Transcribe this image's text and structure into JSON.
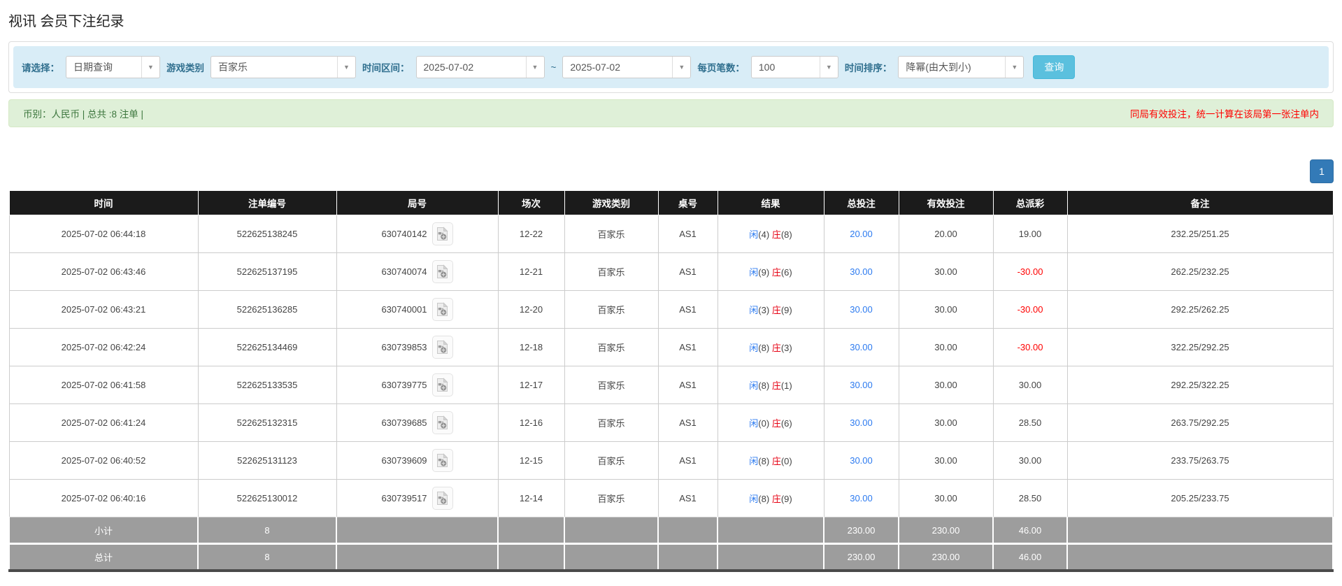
{
  "page": {
    "title": "视讯 会员下注纪录"
  },
  "colors": {
    "accent_blue": "#2d7bf0",
    "banker_red": "#e60012",
    "negative_red": "#ff0000",
    "header_bg": "#1b1b1b",
    "footer_bg": "#9d9d9d",
    "filter_bg": "#d9edf7",
    "filter_label": "#31708f",
    "summary_bg": "#dff0d8",
    "summary_text": "#3c763d",
    "button_bg": "#5bc0de",
    "button_border": "#46b8da",
    "pagination_bg": "#337ab7",
    "pagination_border": "#2e6da4"
  },
  "filters": {
    "select_label": "请选择：",
    "select_value": "日期查询",
    "game_type_label": "游戏类别",
    "game_type_value": "百家乐",
    "time_range_label": "时间区间：",
    "date_from": "2025-07-02",
    "tilde": "~",
    "date_to": "2025-07-02",
    "page_size_label": "每页笔数：",
    "page_size_value": "100",
    "sort_label": "时间排序：",
    "sort_value": "降幂(由大到小)",
    "search_button": "查询"
  },
  "summary": {
    "left": "币别：人民币 | 总共 :8 注单 |",
    "right": "同局有效投注，统一计算在该局第一张注单内"
  },
  "pagination": {
    "page": "1"
  },
  "table": {
    "headers": [
      "时间",
      "注单编号",
      "局号",
      "场次",
      "游戏类别",
      "桌号",
      "结果",
      "总投注",
      "有效投注",
      "总派彩",
      "备注"
    ],
    "rows": [
      {
        "time": "2025-07-02 06:44:18",
        "bet_id": "522625138245",
        "round_id": "630740142",
        "session": "12-22",
        "game": "百家乐",
        "table_no": "AS1",
        "player": "闲",
        "player_score": "(4)",
        "banker": "庄",
        "banker_score": "(8)",
        "total_bet": "20.00",
        "valid_bet": "20.00",
        "payout": "19.00",
        "remark": "232.25/251.25"
      },
      {
        "time": "2025-07-02 06:43:46",
        "bet_id": "522625137195",
        "round_id": "630740074",
        "session": "12-21",
        "game": "百家乐",
        "table_no": "AS1",
        "player": "闲",
        "player_score": "(9)",
        "banker": "庄",
        "banker_score": "(6)",
        "total_bet": "30.00",
        "valid_bet": "30.00",
        "payout": "-30.00",
        "remark": "262.25/232.25"
      },
      {
        "time": "2025-07-02 06:43:21",
        "bet_id": "522625136285",
        "round_id": "630740001",
        "session": "12-20",
        "game": "百家乐",
        "table_no": "AS1",
        "player": "闲",
        "player_score": "(3)",
        "banker": "庄",
        "banker_score": "(9)",
        "total_bet": "30.00",
        "valid_bet": "30.00",
        "payout": "-30.00",
        "remark": "292.25/262.25"
      },
      {
        "time": "2025-07-02 06:42:24",
        "bet_id": "522625134469",
        "round_id": "630739853",
        "session": "12-18",
        "game": "百家乐",
        "table_no": "AS1",
        "player": "闲",
        "player_score": "(8)",
        "banker": "庄",
        "banker_score": "(3)",
        "total_bet": "30.00",
        "valid_bet": "30.00",
        "payout": "-30.00",
        "remark": "322.25/292.25"
      },
      {
        "time": "2025-07-02 06:41:58",
        "bet_id": "522625133535",
        "round_id": "630739775",
        "session": "12-17",
        "game": "百家乐",
        "table_no": "AS1",
        "player": "闲",
        "player_score": "(8)",
        "banker": "庄",
        "banker_score": "(1)",
        "total_bet": "30.00",
        "valid_bet": "30.00",
        "payout": "30.00",
        "remark": "292.25/322.25"
      },
      {
        "time": "2025-07-02 06:41:24",
        "bet_id": "522625132315",
        "round_id": "630739685",
        "session": "12-16",
        "game": "百家乐",
        "table_no": "AS1",
        "player": "闲",
        "player_score": "(0)",
        "banker": "庄",
        "banker_score": "(6)",
        "total_bet": "30.00",
        "valid_bet": "30.00",
        "payout": "28.50",
        "remark": "263.75/292.25"
      },
      {
        "time": "2025-07-02 06:40:52",
        "bet_id": "522625131123",
        "round_id": "630739609",
        "session": "12-15",
        "game": "百家乐",
        "table_no": "AS1",
        "player": "闲",
        "player_score": "(8)",
        "banker": "庄",
        "banker_score": "(0)",
        "total_bet": "30.00",
        "valid_bet": "30.00",
        "payout": "30.00",
        "remark": "233.75/263.75"
      },
      {
        "time": "2025-07-02 06:40:16",
        "bet_id": "522625130012",
        "round_id": "630739517",
        "session": "12-14",
        "game": "百家乐",
        "table_no": "AS1",
        "player": "闲",
        "player_score": "(8)",
        "banker": "庄",
        "banker_score": "(9)",
        "total_bet": "30.00",
        "valid_bet": "30.00",
        "payout": "28.50",
        "remark": "205.25/233.75"
      }
    ],
    "subtotal": {
      "label": "小计",
      "count": "8",
      "total_bet": "230.00",
      "valid_bet": "230.00",
      "payout": "46.00"
    },
    "total": {
      "label": "总计",
      "count": "8",
      "total_bet": "230.00",
      "valid_bet": "230.00",
      "payout": "46.00"
    }
  }
}
